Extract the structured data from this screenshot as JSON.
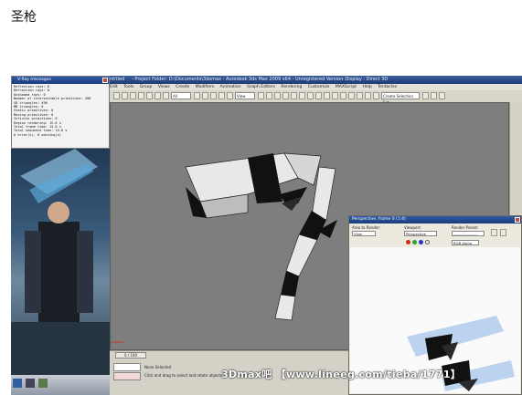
{
  "caption": "圣枪",
  "window": {
    "title_left": "ntitled",
    "title_main": "- Project Folder: D:\\Documents\\3dsmax - Autodesk 3ds Max 2009 x64 - Unregistered Version",
    "title_right": "- Display : Direct 3D"
  },
  "menu": [
    "Edit",
    "Tools",
    "Group",
    "Views",
    "Create",
    "Modifiers",
    "Animation",
    "Graph Editors",
    "Rendering",
    "Customize",
    "MAXScript",
    "Help",
    "Tentacles"
  ],
  "toolbar": {
    "filter_select": "All",
    "view_select": "View",
    "selection_set": "Create Selection Set"
  },
  "vray_window": {
    "title": "V-Ray messages",
    "lines": [
      "Reflection rays: 0",
      "Refraction rays: 0",
      "Unshaded rays: 0",
      "Number of intersectable primitives: 496",
      "  SD triangles: 496",
      "  MB triangles: 0",
      "  Static primitives: 0",
      "  Moving primitives: 0",
      "  Infinite primitives: 0",
      "Region rendering: 15.6 s",
      "Total frame time: 15.6 s",
      "Total sequence time: 15.6 s",
      "0 error(s), 0 warning(s)"
    ]
  },
  "frame_buffer": {
    "title": "Perspective, frame 0 (1:4)",
    "area_label": "Area to Render:",
    "area_value": "View",
    "viewport_label": "Viewport:",
    "viewport_value": "Perspective",
    "preset_label": "Render Preset:",
    "preset_value": "-------------------",
    "channel_value": "RGB Alpha"
  },
  "timeline": {
    "slider": "0 / 100"
  },
  "status": {
    "selection": "None Selected",
    "prompt": "Click and drag to select and rotate objects"
  },
  "watermark": "3Dmax吧 【www.lineeg.com/tieba/1771】",
  "colors": {
    "titlebar": "#2a4d8c",
    "viewport": "#7e7e7e",
    "model_light": "#e8e8e8",
    "model_dark": "#111111",
    "render_tint": "#bcd3ef"
  }
}
